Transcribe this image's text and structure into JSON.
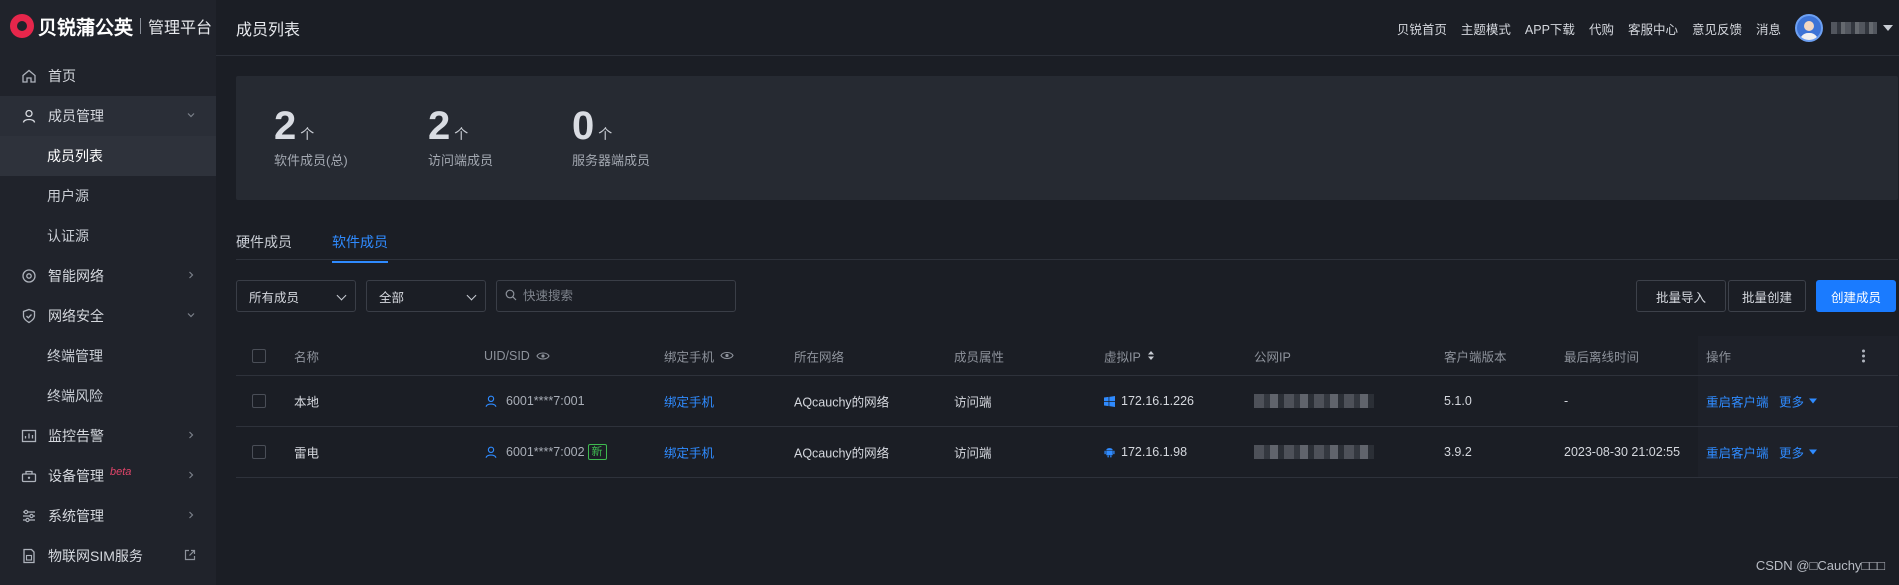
{
  "brand": {
    "name": "贝锐蒲公英",
    "subtitle": "管理平台"
  },
  "sidebar": {
    "items": [
      {
        "label": "首页"
      },
      {
        "label": "成员管理",
        "children": [
          {
            "label": "成员列表"
          },
          {
            "label": "用户源"
          },
          {
            "label": "认证源"
          }
        ]
      },
      {
        "label": "智能网络"
      },
      {
        "label": "网络安全",
        "children": [
          {
            "label": "终端管理"
          },
          {
            "label": "终端风险"
          }
        ]
      },
      {
        "label": "监控告警"
      },
      {
        "label": "设备管理",
        "badge": "beta"
      },
      {
        "label": "系统管理"
      },
      {
        "label": "物联网SIM服务"
      }
    ]
  },
  "header": {
    "title": "成员列表",
    "links": [
      "贝锐首页",
      "主题模式",
      "APP下载",
      "代购",
      "客服中心",
      "意见反馈",
      "消息"
    ]
  },
  "stats": [
    {
      "value": "2",
      "unit": "个",
      "label": "软件成员(总)"
    },
    {
      "value": "2",
      "unit": "个",
      "label": "访问端成员"
    },
    {
      "value": "0",
      "unit": "个",
      "label": "服务器端成员"
    }
  ],
  "tabs": [
    {
      "label": "硬件成员"
    },
    {
      "label": "软件成员",
      "active": true
    }
  ],
  "filters": {
    "member_select": "所有成员",
    "scope_select": "全部",
    "search_placeholder": "快速搜索"
  },
  "actions": {
    "import": "批量导入",
    "batch_create": "批量创建",
    "create": "创建成员"
  },
  "table": {
    "columns": [
      "名称",
      "UID/SID",
      "绑定手机",
      "所在网络",
      "成员属性",
      "虚拟IP",
      "公网IP",
      "客户端版本",
      "最后离线时间",
      "操作"
    ],
    "rows": [
      {
        "name": "本地",
        "uid": "6001****7:001",
        "is_new": false,
        "phone": "绑定手机",
        "network": "AQcauchy的网络",
        "attr": "访问端",
        "os": "windows-icon",
        "vip": "172.16.1.226",
        "version": "5.1.0",
        "last_offline": "-",
        "restart": "重启客户端",
        "more": "更多"
      },
      {
        "name": "雷电",
        "uid": "6001****7:002",
        "is_new": true,
        "new_label": "新",
        "phone": "绑定手机",
        "network": "AQcauchy的网络",
        "attr": "访问端",
        "os": "android-icon",
        "vip": "172.16.1.98",
        "version": "3.9.2",
        "last_offline": "2023-08-30 21:02:55",
        "restart": "重启客户端",
        "more": "更多"
      }
    ]
  },
  "watermark": "CSDN @□Cauchy□□□",
  "colors": {
    "accent": "#1a7bff",
    "link": "#2f8bff",
    "new_tag": "#3fb950",
    "beta": "#e0456a",
    "bg": "#1b1e25",
    "sidebar_bg": "#20232b"
  }
}
